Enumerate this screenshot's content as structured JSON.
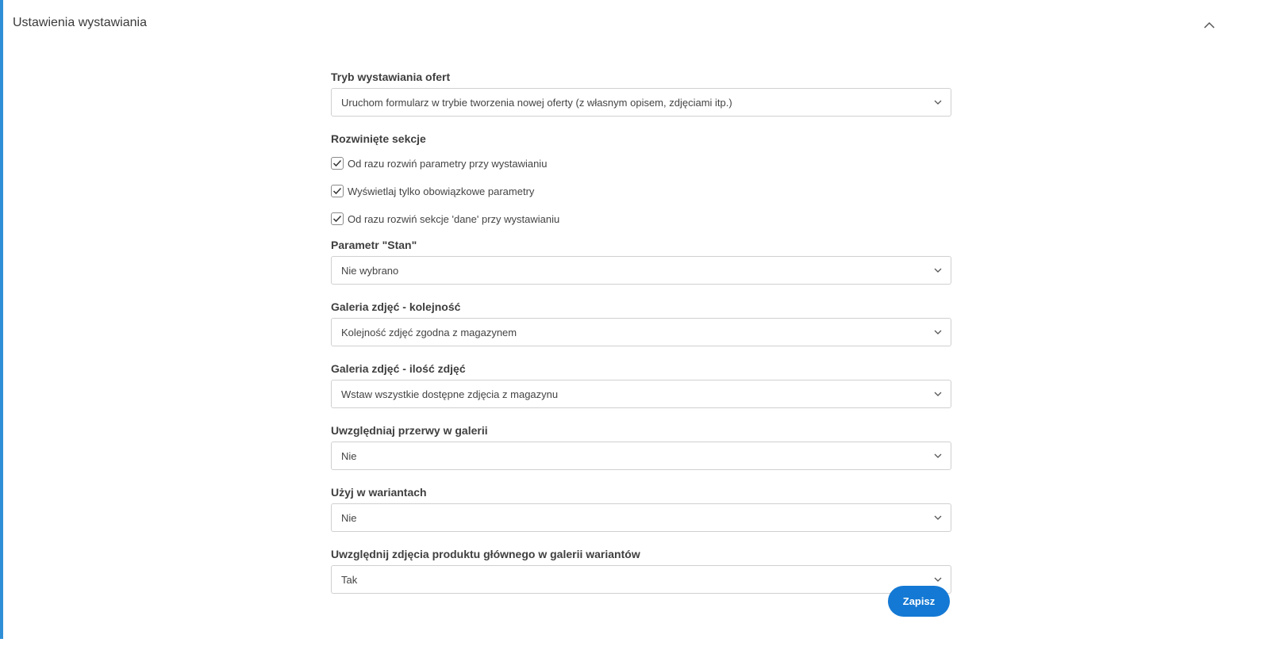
{
  "panel": {
    "title": "Ustawienia wystawiania",
    "accent_color": "#2f8fd6",
    "collapse_icon": "chevron-up-icon"
  },
  "fields": {
    "mode": {
      "label": "Tryb wystawiania ofert",
      "value": "Uruchom formularz w trybie tworzenia nowej oferty (z własnym opisem, zdjęciami itp.)"
    },
    "sections": {
      "label": "Rozwinięte sekcje",
      "checkboxes": [
        {
          "label": "Od razu rozwiń parametry przy wystawianiu",
          "checked": true
        },
        {
          "label": "Wyświetlaj tylko obowiązkowe parametry",
          "checked": true
        },
        {
          "label": "Od razu rozwiń sekcje 'dane' przy wystawianiu",
          "checked": true
        }
      ]
    },
    "condition": {
      "label": "Parametr \"Stan\"",
      "value": "Nie wybrano"
    },
    "gallery_order": {
      "label": "Galeria zdjęć - kolejność",
      "value": "Kolejność zdjęć zgodna z magazynem"
    },
    "gallery_count": {
      "label": "Galeria zdjęć - ilość zdjęć",
      "value": "Wstaw wszystkie dostępne zdjęcia z magazynu"
    },
    "gallery_breaks": {
      "label": "Uwzględniaj przerwy w galerii",
      "value": "Nie"
    },
    "use_in_variants": {
      "label": "Użyj w wariantach",
      "value": "Nie"
    },
    "main_product_photos": {
      "label": "Uwzględnij zdjęcia produktu głównego w galerii wariantów",
      "value": "Tak"
    }
  },
  "actions": {
    "save_label": "Zapisz",
    "save_color": "#1479d4"
  }
}
